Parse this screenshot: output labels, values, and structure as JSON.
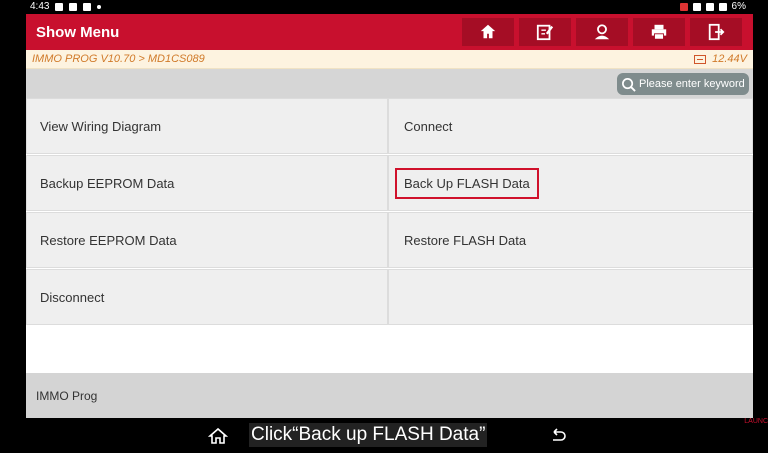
{
  "status_bar": {
    "time": "4:43",
    "battery": "6%"
  },
  "header": {
    "title": "Show Menu",
    "toolbar_icons": [
      "home-icon",
      "edit-report-icon",
      "user-profile-icon",
      "printer-icon",
      "exit-icon"
    ]
  },
  "breadcrumb": {
    "path": "IMMO PROG V10.70 > MD1CS089",
    "voltage": "12.44V"
  },
  "search": {
    "placeholder": "Please enter keyword"
  },
  "menu": {
    "items": [
      {
        "label": "View Wiring Diagram"
      },
      {
        "label": "Connect"
      },
      {
        "label": "Backup EEPROM Data"
      },
      {
        "label": "Back Up FLASH Data"
      },
      {
        "label": "Restore EEPROM Data"
      },
      {
        "label": "Restore FLASH Data"
      },
      {
        "label": "Disconnect"
      },
      {
        "label": ""
      }
    ]
  },
  "footer": {
    "label": "IMMO Prog"
  },
  "caption": {
    "text": "Click“Back up FLASH Data”"
  },
  "watermark": {
    "text": "LAUNC"
  },
  "colors": {
    "brand_red": "#c8102e",
    "highlight_red": "#d0112b",
    "crumb_orange": "#d07a2a"
  }
}
